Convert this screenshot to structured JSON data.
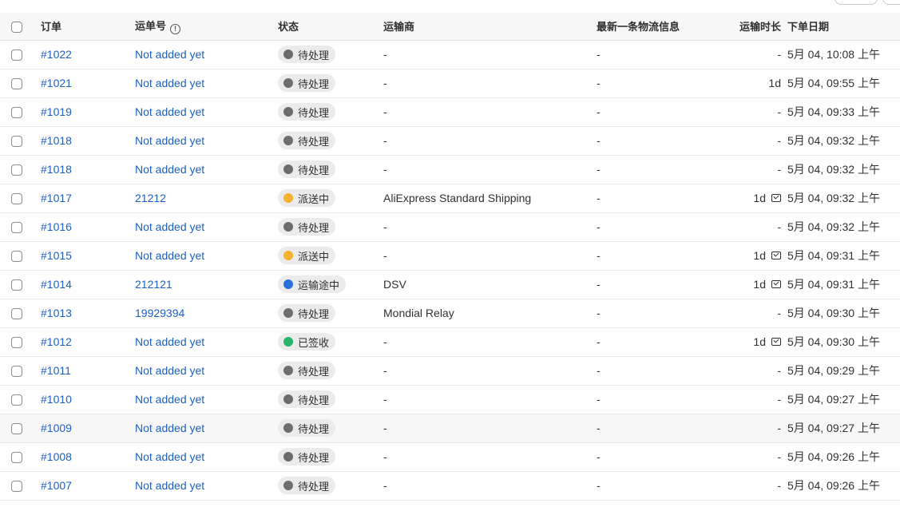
{
  "headers": {
    "order": "订单",
    "tracking": "运单号",
    "status": "状态",
    "carrier": "运输商",
    "latest_info": "最新一条物流信息",
    "duration": "运输时长",
    "order_date": "下单日期"
  },
  "status_colors": {
    "pending": "#6d6d6d",
    "out_for_delivery": "#f6b02c",
    "in_transit": "#2a6fdb",
    "delivered": "#26b56b"
  },
  "rows": [
    {
      "order": "#1022",
      "tracking": "Not added yet",
      "status": "待处理",
      "status_color": "#6d6d6d",
      "carrier": "-",
      "latest": "-",
      "duration": "-",
      "mail": false,
      "date": "5月 04, 10:08 上午"
    },
    {
      "order": "#1021",
      "tracking": "Not added yet",
      "status": "待处理",
      "status_color": "#6d6d6d",
      "carrier": "-",
      "latest": "-",
      "duration": "1d",
      "mail": false,
      "date": "5月 04, 09:55 上午"
    },
    {
      "order": "#1019",
      "tracking": "Not added yet",
      "status": "待处理",
      "status_color": "#6d6d6d",
      "carrier": "-",
      "latest": "-",
      "duration": "-",
      "mail": false,
      "date": "5月 04, 09:33 上午"
    },
    {
      "order": "#1018",
      "tracking": "Not added yet",
      "status": "待处理",
      "status_color": "#6d6d6d",
      "carrier": "-",
      "latest": "-",
      "duration": "-",
      "mail": false,
      "date": "5月 04, 09:32 上午"
    },
    {
      "order": "#1018",
      "tracking": "Not added yet",
      "status": "待处理",
      "status_color": "#6d6d6d",
      "carrier": "-",
      "latest": "-",
      "duration": "-",
      "mail": false,
      "date": "5月 04, 09:32 上午"
    },
    {
      "order": "#1017",
      "tracking": "21212",
      "status": "派送中",
      "status_color": "#f6b02c",
      "carrier": "AliExpress Standard Shipping",
      "latest": "-",
      "duration": "1d",
      "mail": true,
      "date": "5月 04, 09:32 上午"
    },
    {
      "order": "#1016",
      "tracking": "Not added yet",
      "status": "待处理",
      "status_color": "#6d6d6d",
      "carrier": "-",
      "latest": "-",
      "duration": "-",
      "mail": false,
      "date": "5月 04, 09:32 上午"
    },
    {
      "order": "#1015",
      "tracking": "Not added yet",
      "status": "派送中",
      "status_color": "#f6b02c",
      "carrier": "-",
      "latest": "-",
      "duration": "1d",
      "mail": true,
      "date": "5月 04, 09:31 上午"
    },
    {
      "order": "#1014",
      "tracking": "212121",
      "status": "运输途中",
      "status_color": "#2a6fdb",
      "carrier": "DSV",
      "latest": "-",
      "duration": "1d",
      "mail": true,
      "date": "5月 04, 09:31 上午"
    },
    {
      "order": "#1013",
      "tracking": "19929394",
      "status": "待处理",
      "status_color": "#6d6d6d",
      "carrier": "Mondial Relay",
      "latest": "-",
      "duration": "-",
      "mail": false,
      "date": "5月 04, 09:30 上午"
    },
    {
      "order": "#1012",
      "tracking": "Not added yet",
      "status": "已签收",
      "status_color": "#26b56b",
      "carrier": "-",
      "latest": "-",
      "duration": "1d",
      "mail": true,
      "date": "5月 04, 09:30 上午"
    },
    {
      "order": "#1011",
      "tracking": "Not added yet",
      "status": "待处理",
      "status_color": "#6d6d6d",
      "carrier": "-",
      "latest": "-",
      "duration": "-",
      "mail": false,
      "date": "5月 04, 09:29 上午"
    },
    {
      "order": "#1010",
      "tracking": "Not added yet",
      "status": "待处理",
      "status_color": "#6d6d6d",
      "carrier": "-",
      "latest": "-",
      "duration": "-",
      "mail": false,
      "date": "5月 04, 09:27 上午"
    },
    {
      "order": "#1009",
      "tracking": "Not added yet",
      "status": "待处理",
      "status_color": "#6d6d6d",
      "carrier": "-",
      "latest": "-",
      "duration": "-",
      "mail": false,
      "date": "5月 04, 09:27 上午",
      "highlight": true
    },
    {
      "order": "#1008",
      "tracking": "Not added yet",
      "status": "待处理",
      "status_color": "#6d6d6d",
      "carrier": "-",
      "latest": "-",
      "duration": "-",
      "mail": false,
      "date": "5月 04, 09:26 上午"
    },
    {
      "order": "#1007",
      "tracking": "Not added yet",
      "status": "待处理",
      "status_color": "#6d6d6d",
      "carrier": "-",
      "latest": "-",
      "duration": "-",
      "mail": false,
      "date": "5月 04, 09:26 上午"
    }
  ]
}
